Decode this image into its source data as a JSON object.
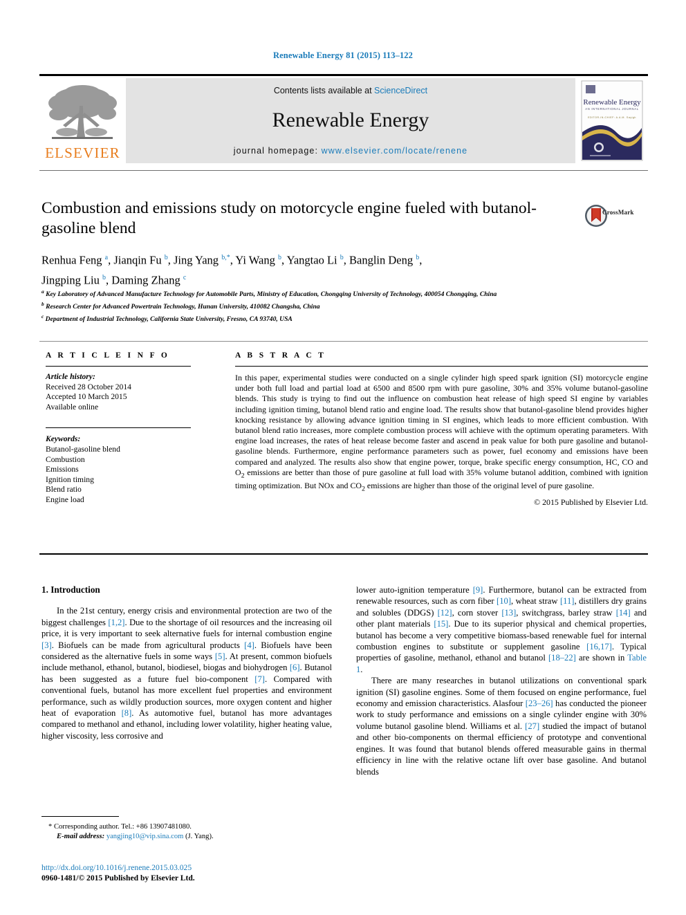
{
  "running_head": "Renewable Energy 81 (2015) 113–122",
  "masthead": {
    "contents_prefix": "Contents lists available at ",
    "sciencedirect": "ScienceDirect",
    "journal_name": "Renewable Energy",
    "homepage_prefix": "journal homepage: ",
    "homepage_url": "www.elsevier.com/locate/renene",
    "publisher_logo_text": "ELSEVIER",
    "cover_title": "Renewable Energy",
    "cover_subtitle": "AN INTERNATIONAL JOURNAL",
    "cover_editors": "EDITOR-IN-CHIEF: A.A.M. Sayigh"
  },
  "badge": {
    "crossmark_label": "CrossMark"
  },
  "article": {
    "title": "Combustion and emissions study on motorcycle engine fueled with butanol-gasoline blend",
    "authors_line1": "Renhua Feng <sup>a</sup>, Jianqin Fu <sup>b</sup>, Jing Yang <sup>b,*</sup>, Yi Wang <sup>b</sup>, Yangtao Li <sup>b</sup>, Banglin Deng <sup>b</sup>,",
    "authors_line2": "Jingping Liu <sup>b</sup>, Daming Zhang <sup>c</sup>",
    "affiliations": [
      "<sup>a</sup> Key Laboratory of Advanced Manufacture Technology for Automobile Parts, Ministry of Education, Chongqing University of Technology, 400054 Chongqing, China",
      "<sup>b</sup> Research Center for Advanced Powertrain Technology, Hunan University, 410082 Changsha, China",
      "<sup>c</sup> Department of Industrial Technology, California State University, Fresno, CA 93740, USA"
    ]
  },
  "article_info": {
    "heading": "A R T I C L E   I N F O",
    "history_label": "Article history:",
    "history": [
      "Received 28 October 2014",
      "Accepted 10 March 2015",
      "Available online"
    ],
    "keywords_label": "Keywords:",
    "keywords": [
      "Butanol-gasoline blend",
      "Combustion",
      "Emissions",
      "Ignition timing",
      "Blend ratio",
      "Engine load"
    ]
  },
  "abstract": {
    "heading": "A B S T R A C T",
    "text": "In this paper, experimental studies were conducted on a single cylinder high speed spark ignition (SI) motorcycle engine under both full load and partial load at 6500 and 8500 rpm with pure gasoline, 30% and 35% volume butanol-gasoline blends. This study is trying to find out the influence on combustion heat release of high speed SI engine by variables including ignition timing, butanol blend ratio and engine load. The results show that butanol-gasoline blend provides higher knocking resistance by allowing advance ignition timing in SI engines, which leads to more efficient combustion. With butanol blend ratio increases, more complete combustion process will achieve with the optimum operating parameters. With engine load increases, the rates of heat release become faster and ascend in peak value for both pure gasoline and butanol-gasoline blends. Furthermore, engine performance parameters such as power, fuel economy and emissions have been compared and analyzed. The results also show that engine power, torque, brake specific energy consumption, HC, CO and O<sub>2</sub> emissions are better than those of pure gasoline at full load with 35% volume butanol addition, combined with ignition timing optimization. But NOx and CO<sub>2</sub> emissions are higher than those of the original level of pure gasoline.",
    "copyright": "© 2015 Published by Elsevier Ltd."
  },
  "body": {
    "section_heading": "1.  Introduction",
    "left_paragraphs": [
      "In the 21st century, energy crisis and environmental protection are two of the biggest challenges <span class=\"ref\">[1,2]</span>. Due to the shortage of oil resources and the increasing oil price, it is very important to seek alternative fuels for internal combustion engine <span class=\"ref\">[3]</span>. Biofuels can be made from agricultural products <span class=\"ref\">[4]</span>. Biofuels have been considered as the alternative fuels in some ways <span class=\"ref\">[5]</span>. At present, common biofuels include methanol, ethanol, butanol, biodiesel, biogas and biohydrogen <span class=\"ref\">[6]</span>. Butanol has been suggested as a future fuel bio-component <span class=\"ref\">[7]</span>. Compared with conventional fuels, butanol has more excellent fuel properties and environment performance, such as wildly production sources, more oxygen content and higher heat of evaporation <span class=\"ref\">[8]</span>. As automotive fuel, butanol has more advantages compared to methanol and ethanol, including lower volatility, higher heating value, higher viscosity, less corrosive and"
    ],
    "right_paragraphs": [
      "lower auto-ignition temperature <span class=\"ref\">[9]</span>. Furthermore, butanol can be extracted from renewable resources, such as corn fiber <span class=\"ref\">[10]</span>, wheat straw <span class=\"ref\">[11]</span>, distillers dry grains and solubles (DDGS) <span class=\"ref\">[12]</span>, corn stover <span class=\"ref\">[13]</span>, switchgrass, barley straw <span class=\"ref\">[14]</span> and other plant materials <span class=\"ref\">[15]</span>. Due to its superior physical and chemical properties, butanol has become a very competitive biomass-based renewable fuel for internal combustion engines to substitute or supplement gasoline <span class=\"ref\">[16,17]</span>. Typical properties of gasoline, methanol, ethanol and butanol <span class=\"ref\">[18–22]</span> are shown in <span class=\"tablelink\">Table 1</span>.",
      "There are many researches in butanol utilizations on conventional spark ignition (SI) gasoline engines. Some of them focused on engine performance, fuel economy and emission characteristics. Alasfour <span class=\"ref\">[23–26]</span> has conducted the pioneer work to study performance and emissions on a single cylinder engine with 30% volume butanol gasoline blend. Williams et al. <span class=\"ref\">[27]</span> studied the impact of butanol and other bio-components on thermal efficiency of prototype and conventional engines. It was found that butanol blends offered measurable gains in thermal efficiency in line with the relative octane lift over base gasoline. And butanol blends"
    ]
  },
  "footnote": {
    "corresponding": "* Corresponding author. Tel.: +86 13907481080.",
    "email_label": "E-mail address:",
    "email": "yangjing10@vip.sina.com",
    "email_suffix": "(J. Yang)."
  },
  "footer": {
    "doi": "http://dx.doi.org/10.1016/j.renene.2015.03.025",
    "issn": "0960-1481/© 2015 Published by Elsevier Ltd."
  },
  "colors": {
    "link": "#1a7bb9",
    "elsevier_orange": "#e87d1e",
    "masthead_bg": "#e3e3e3",
    "cover_navy": "#2b2a5e",
    "cover_gold": "#d9b54a"
  }
}
